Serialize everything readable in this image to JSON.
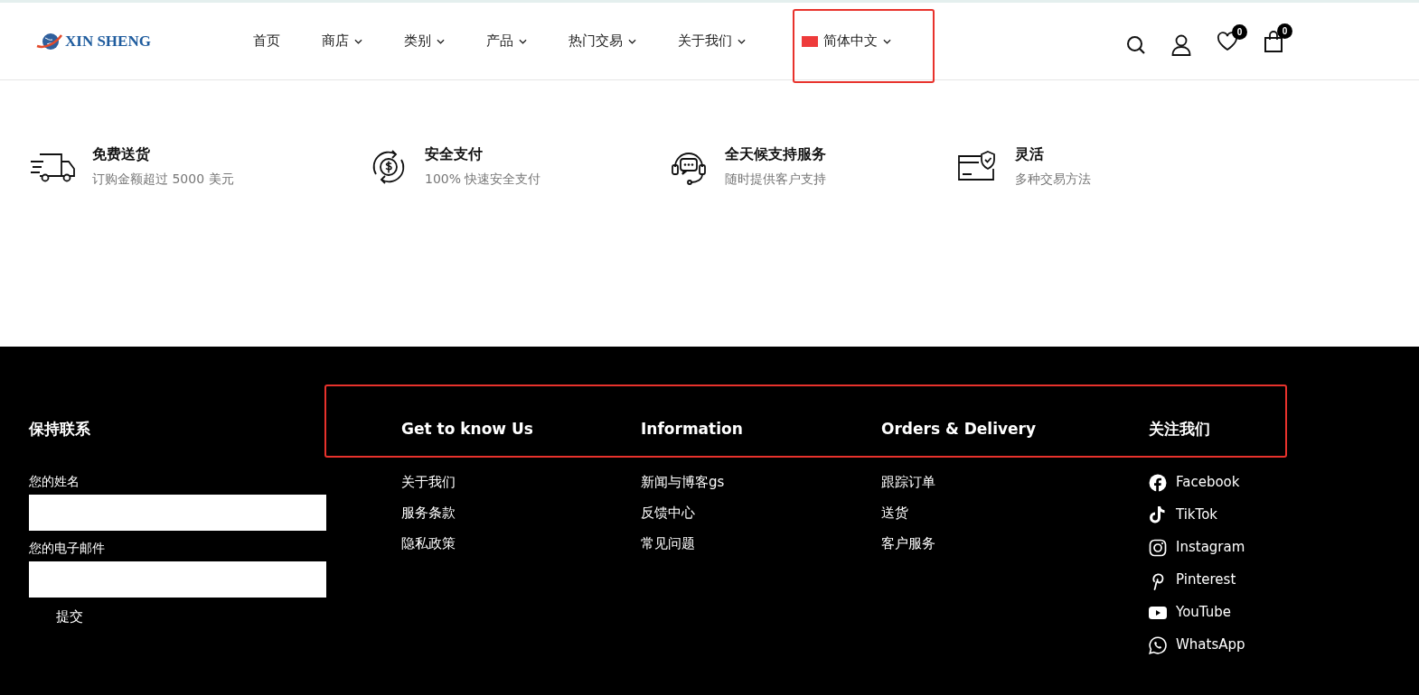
{
  "logo": {
    "text": "XIN SHENG"
  },
  "nav": [
    {
      "label": "首页",
      "dropdown": false
    },
    {
      "label": "商店",
      "dropdown": true
    },
    {
      "label": "类别",
      "dropdown": true
    },
    {
      "label": "产品",
      "dropdown": true
    },
    {
      "label": "热门交易",
      "dropdown": true
    },
    {
      "label": "关于我们",
      "dropdown": true
    }
  ],
  "language": {
    "label": "简体中文"
  },
  "header_icons": {
    "wishlist_count": "0",
    "cart_count": "0"
  },
  "features": [
    {
      "kind": "truck",
      "title": "免费送货",
      "subtitle": "订购金额超过 5000 美元"
    },
    {
      "kind": "payment",
      "title": "安全支付",
      "subtitle": "100% 快速安全支付"
    },
    {
      "kind": "support",
      "title": "全天候支持服务",
      "subtitle": "随时提供客户支持"
    },
    {
      "kind": "card",
      "title": "灵活",
      "subtitle": "多种交易方法"
    }
  ],
  "footer": {
    "contact": {
      "title": "保持联系",
      "fields": [
        {
          "label": "您的姓名"
        },
        {
          "label": "您的电子邮件"
        }
      ],
      "submit": "提交"
    },
    "columns": [
      {
        "title": "Get to know Us",
        "links": [
          "关于我们",
          "服务条款",
          "隐私政策"
        ]
      },
      {
        "title": "Information",
        "links": [
          "新闻与博客gs",
          "反馈中心",
          "常见问题"
        ]
      },
      {
        "title": "Orders & Delivery",
        "links": [
          "跟踪订单",
          "送货",
          "客户服务"
        ]
      }
    ],
    "social": {
      "title": "关注我们",
      "links": [
        {
          "kind": "facebook",
          "label": "Facebook"
        },
        {
          "kind": "tiktok",
          "label": "TikTok"
        },
        {
          "kind": "instagram",
          "label": "Instagram"
        },
        {
          "kind": "pinterest",
          "label": "Pinterest"
        },
        {
          "kind": "youtube",
          "label": "YouTube"
        },
        {
          "kind": "whatsapp",
          "label": "WhatsApp"
        }
      ]
    }
  }
}
